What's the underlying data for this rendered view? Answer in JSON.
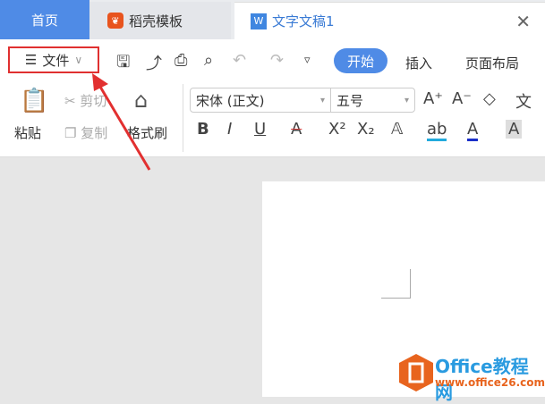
{
  "tabs": [
    {
      "label": "首页"
    },
    {
      "label": "稻壳模板"
    },
    {
      "label": "文字文稿1"
    }
  ],
  "toolbar": {
    "file_label": "文件",
    "start": "开始",
    "insert": "插入",
    "layout": "页面布局"
  },
  "ribbon": {
    "paste": "粘贴",
    "cut": "剪切",
    "copy": "复制",
    "format_painter": "格式刷",
    "font": "宋体 (正文)",
    "size": "五号"
  },
  "watermark": {
    "title": "Office教程网",
    "url": "www.office26.com"
  }
}
